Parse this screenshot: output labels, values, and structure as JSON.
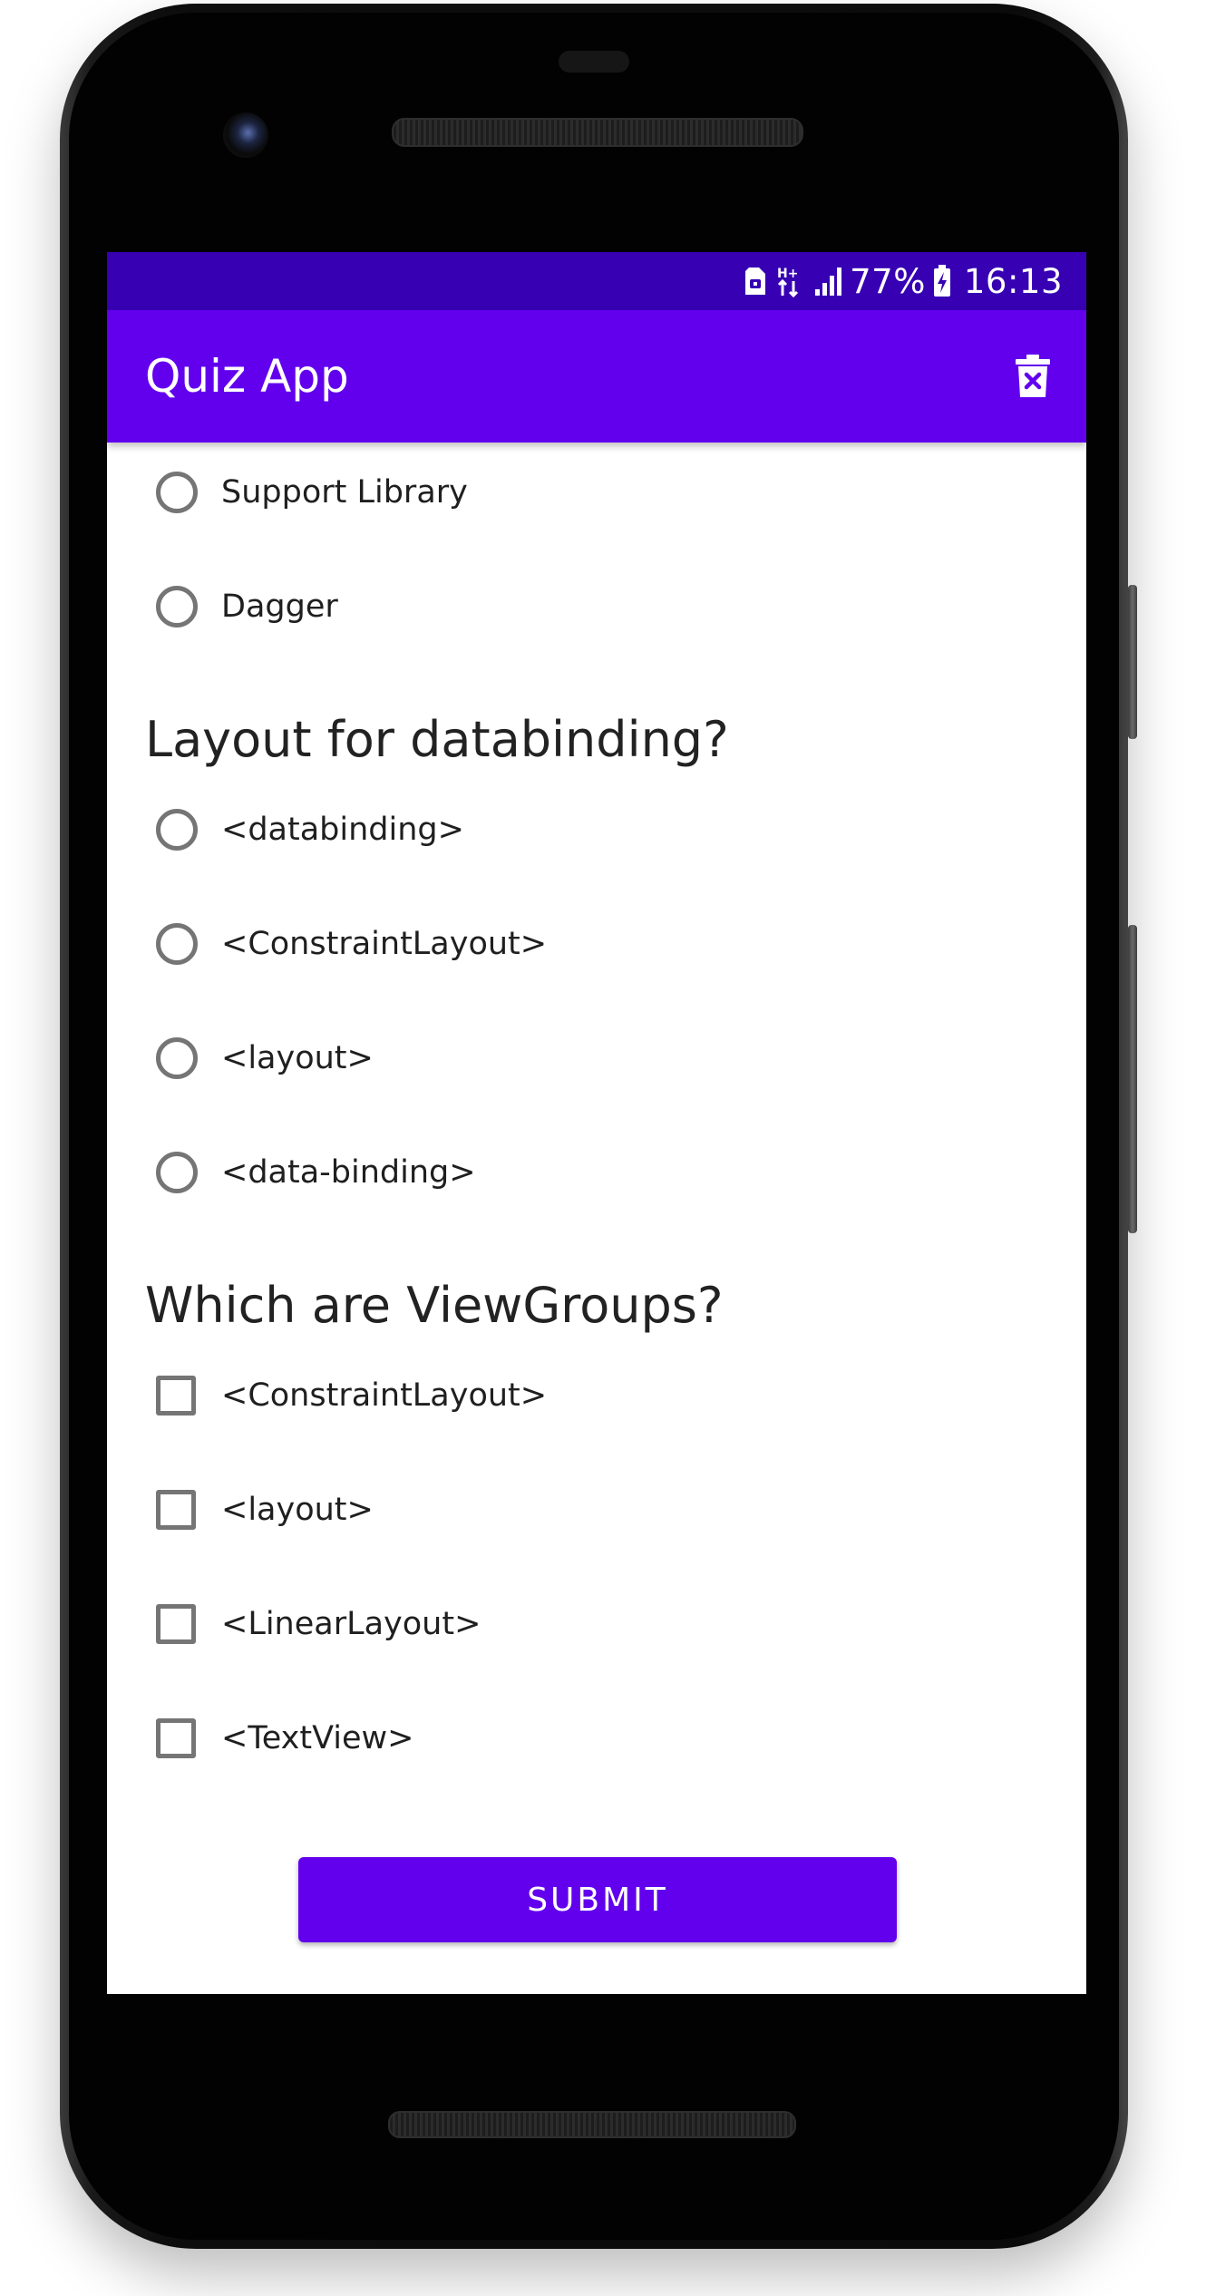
{
  "status_bar": {
    "battery_percent": "77%",
    "time": "16:13",
    "network_type": "H+",
    "icons": [
      "sim-icon",
      "network-hplus-icon",
      "signal-icon",
      "battery-charging-icon"
    ]
  },
  "app_bar": {
    "title": "Quiz App",
    "action_icon": "delete-icon"
  },
  "questions": [
    {
      "title": "",
      "type": "radio",
      "options": [
        "Support Library",
        "Dagger"
      ]
    },
    {
      "title": "Layout for databinding?",
      "type": "radio",
      "options": [
        "<databinding>",
        "<ConstraintLayout>",
        "<layout>",
        "<data-binding>"
      ]
    },
    {
      "title": "Which are ViewGroups?",
      "type": "checkbox",
      "options": [
        "<ConstraintLayout>",
        "<layout>",
        "<LinearLayout>",
        "<TextView>"
      ]
    }
  ],
  "submit_label": "SUBMIT",
  "colors": {
    "primary": "#6200ee",
    "primary_dark": "#3700b3",
    "control_border": "#757575"
  }
}
